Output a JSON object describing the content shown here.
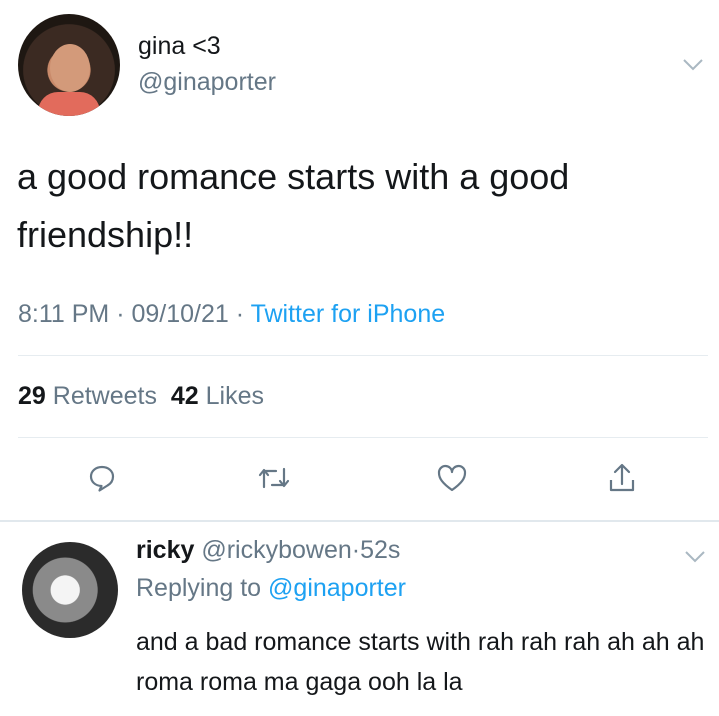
{
  "tweet": {
    "display_name": "gina <3",
    "handle": "@ginaporter",
    "text": "a good romance starts with a good friendship!!",
    "time": "8:11 PM",
    "date": "09/10/21",
    "source": "Twitter for iPhone",
    "retweets_count": "29",
    "retweets_label": "Retweets",
    "likes_count": "42",
    "likes_label": "Likes",
    "actions": {
      "reply_icon": "reply-icon",
      "retweet_icon": "retweet-icon",
      "like_icon": "heart-icon",
      "share_icon": "share-icon"
    }
  },
  "reply": {
    "display_name": "ricky",
    "handle": "@rickybowen",
    "time": "52s",
    "replying_prefix": "Replying to",
    "replying_to": "@ginaporter",
    "text": "and a bad romance starts with rah rah rah ah ah ah roma roma ma gaga ooh la la"
  },
  "colors": {
    "text": "#14171a",
    "secondary": "#657786",
    "accent": "#1da1f2",
    "divider": "#e6ecf0"
  }
}
